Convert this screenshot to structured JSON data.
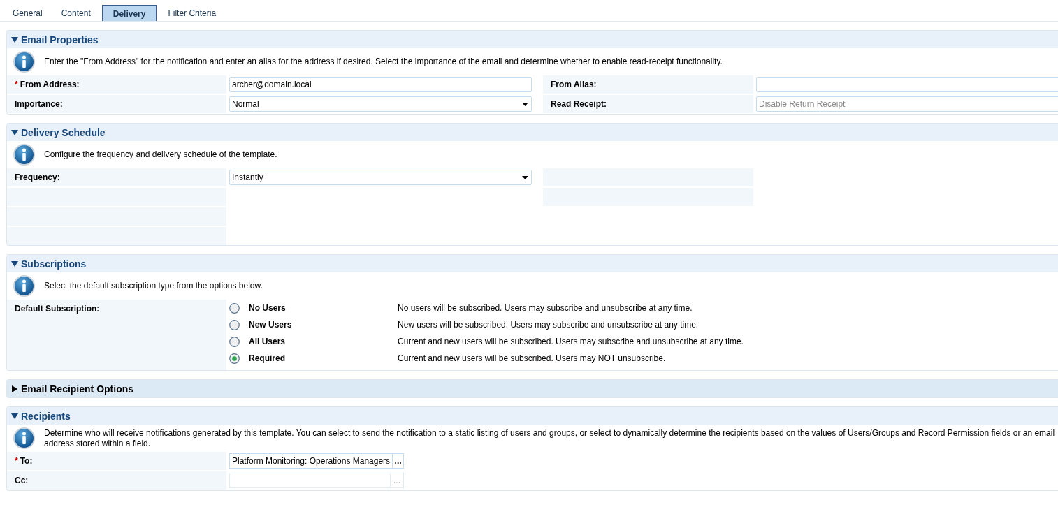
{
  "tabs": [
    {
      "label": "General",
      "selected": false
    },
    {
      "label": "Content",
      "selected": false
    },
    {
      "label": "Delivery",
      "selected": true
    },
    {
      "label": "Filter Criteria",
      "selected": false
    }
  ],
  "sections": [
    {
      "kind": "fields",
      "title": "Email Properties",
      "expanded": true,
      "info": "Enter the \"From Address\" for the notification and enter an alias for the address if desired. Select the importance of the email and determine whether to enable read-receipt functionality.",
      "rows": [
        [
          {
            "label": "From Address:",
            "mark": "*",
            "kind": "input",
            "value": "archer@domain.local"
          },
          {
            "label": "From Alias:",
            "kind": "input"
          }
        ],
        [
          {
            "label": "Importance:",
            "kind": "select",
            "value": "Normal",
            "disabled": false
          },
          {
            "label": "Read Receipt:",
            "kind": "select",
            "value": "Disable Return Receipt",
            "disabled": true
          }
        ]
      ]
    },
    {
      "kind": "schedule",
      "title": "Delivery Schedule",
      "expanded": true,
      "info": "Configure the frequency and delivery schedule of the template.",
      "rows": [
        [
          {
            "label": "Frequency:",
            "kind": "select",
            "value": "Instantly",
            "disabled": false
          }
        ]
      ]
    },
    {
      "kind": "radios",
      "title": "Subscriptions",
      "expanded": true,
      "info": "Select the default subscription type from the options below.",
      "label": "Default Subscription:",
      "options": [
        {
          "label": "No Users",
          "description": "No users will be subscribed. Users may subscribe and unsubscribe at any time.",
          "selected": false
        },
        {
          "label": "New Users",
          "description": "New users will be subscribed. Users may subscribe and unsubscribe at any time.",
          "selected": false
        },
        {
          "label": "All Users",
          "description": "Current and new users will be subscribed. Users may subscribe and unsubscribe at any time.",
          "selected": false
        },
        {
          "label": "Required",
          "description": "Current and new users will be subscribed. Users may NOT unsubscribe.",
          "selected": true
        }
      ]
    },
    {
      "kind": "fields",
      "title": "Email Recipient Options",
      "expanded": false
    },
    {
      "kind": "fields",
      "title": "Recipients",
      "expanded": true,
      "info": "Determine who will receive notifications generated by this template. You can select to send the notification to a static listing of users and groups, or select to dynamically determine the recipients based on the values of Users/Groups and Record Permission fields or an email address stored within a field.",
      "rows": [
        [
          {
            "label": "To:",
            "mark": "*",
            "kind": "picker",
            "value": "Platform Monitoring: Operations Managers",
            "button": "...",
            "disabled": false
          }
        ],
        [
          {
            "label": "Cc:",
            "kind": "picker",
            "button": "...",
            "disabled": true
          }
        ]
      ]
    }
  ]
}
